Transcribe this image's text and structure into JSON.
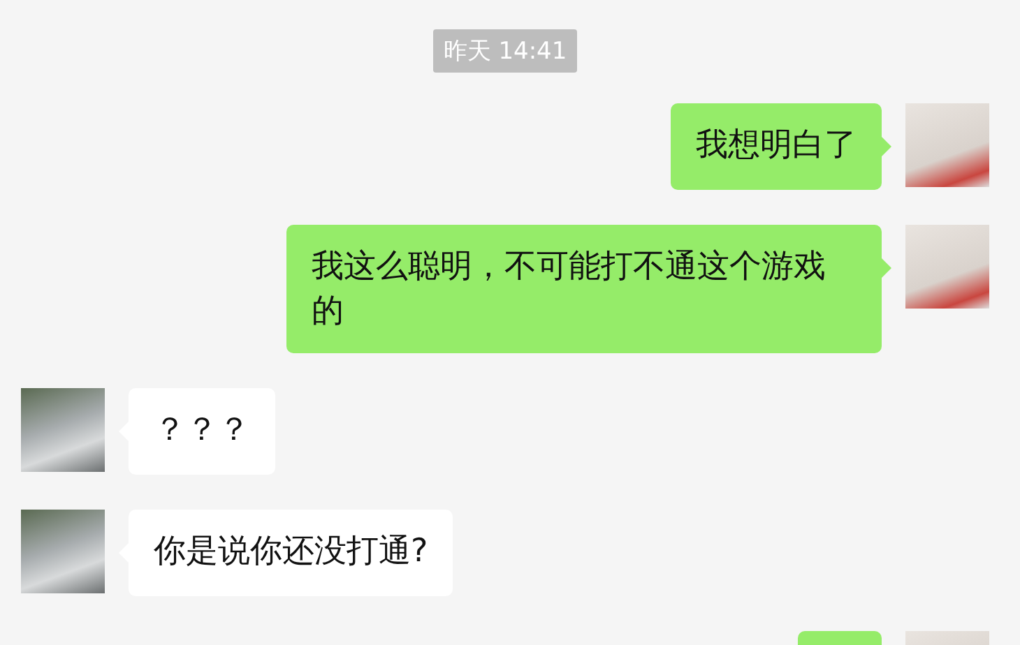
{
  "timestamp": "昨天 14:41",
  "messages": [
    {
      "kind": "sent",
      "text": "我想明白了"
    },
    {
      "kind": "sent",
      "text": "我这么聪明，不可能打不通这个游戏的"
    },
    {
      "kind": "received",
      "text": "？？？"
    },
    {
      "kind": "received",
      "text": "你是说你还没打通?"
    },
    {
      "kind": "sent"
    }
  ]
}
